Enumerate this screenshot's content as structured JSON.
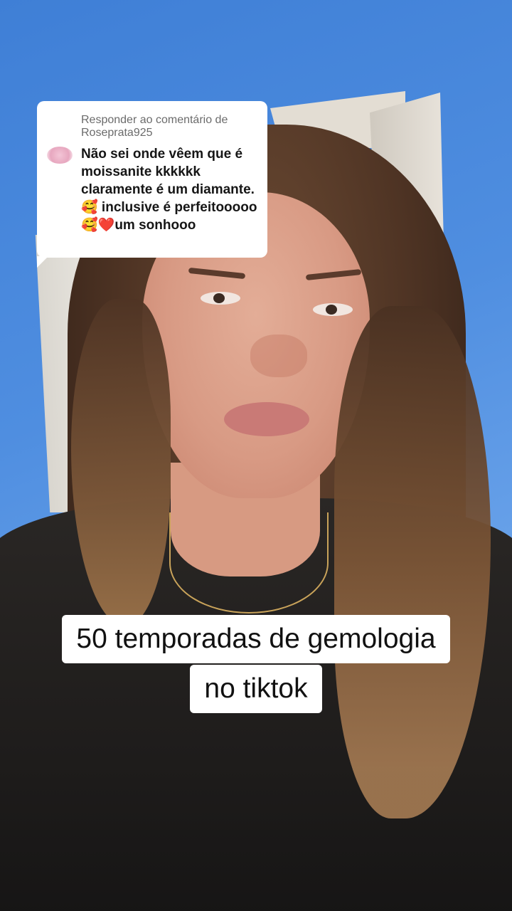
{
  "comment_reply": {
    "header": "Responder ao comentário de Roseprata925",
    "avatar_icon": "user-avatar-icon",
    "text": "Não sei onde vêem que é moissanite kkkkkk claramente é um diamante.🥰 inclusive é perfeitooooo🥰❤️um sonhooo"
  },
  "caption": {
    "line1": "50 temporadas de gemologia",
    "line2": "no tiktok"
  },
  "colors": {
    "background_wall": "#4a86d9",
    "bubble_bg": "#ffffff",
    "caption_bg": "#ffffff"
  }
}
